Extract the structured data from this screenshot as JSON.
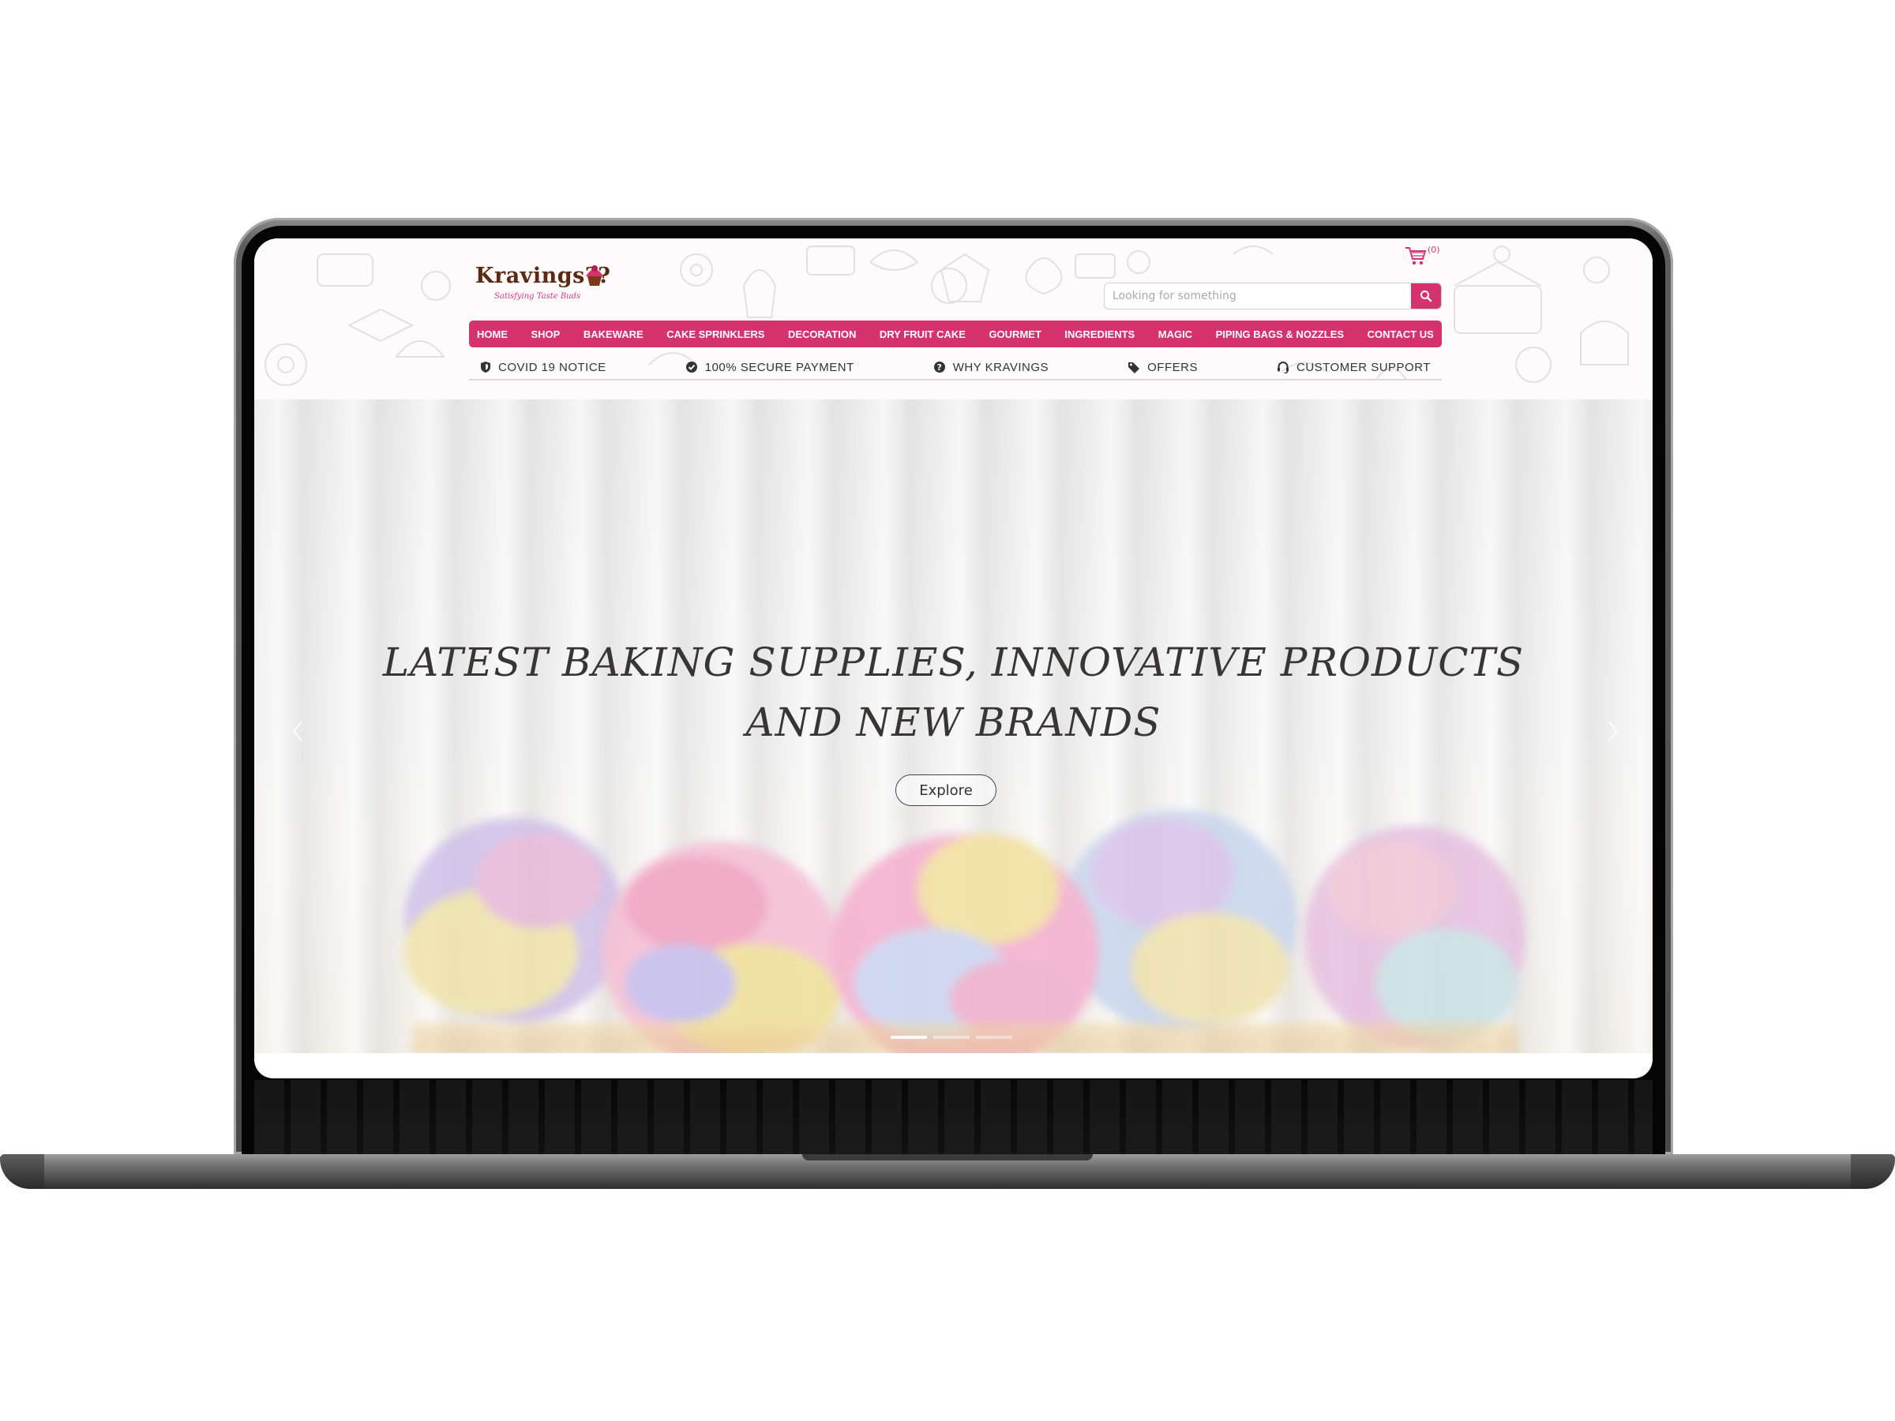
{
  "brand": {
    "name": "Kravings??",
    "tagline": "Satisfying Taste Buds"
  },
  "cart": {
    "count_label": "(0)"
  },
  "search": {
    "placeholder": "Looking for something"
  },
  "nav": {
    "items": [
      {
        "label": "HOME"
      },
      {
        "label": "SHOP"
      },
      {
        "label": "BAKEWARE"
      },
      {
        "label": "CAKE SPRINKLERS"
      },
      {
        "label": "DECORATION"
      },
      {
        "label": "DRY FRUIT CAKE"
      },
      {
        "label": "GOURMET"
      },
      {
        "label": "INGREDIENTS"
      },
      {
        "label": "MAGIC"
      },
      {
        "label": "PIPING BAGS & NOZZLES"
      },
      {
        "label": "CONTACT US"
      }
    ]
  },
  "info_bar": {
    "items": [
      {
        "label": "COVID 19 NOTICE",
        "icon": "shield-icon"
      },
      {
        "label": "100% SECURE PAYMENT",
        "icon": "check-circle-icon"
      },
      {
        "label": "WHY KRAVINGS",
        "icon": "question-circle-icon"
      },
      {
        "label": "OFFERS",
        "icon": "tag-icon"
      },
      {
        "label": "CUSTOMER SUPPORT",
        "icon": "headset-icon"
      }
    ]
  },
  "hero": {
    "title_line1": "LATEST BAKING SUPPLIES, INNOVATIVE PRODUCTS",
    "title_line2": "AND NEW BRANDS",
    "button_label": "Explore"
  },
  "colors": {
    "accent": "#d6336c",
    "logo_brown": "#5a2a12",
    "text_dark": "#3a3535",
    "laptop_frame": "#4a4a4a"
  }
}
